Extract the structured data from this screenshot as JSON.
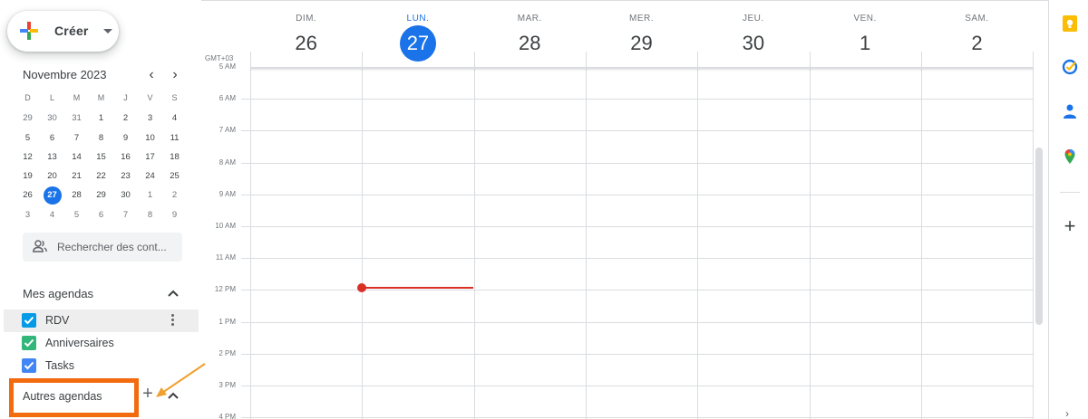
{
  "sidebar": {
    "create_label": "Créer",
    "mini_calendar": {
      "title": "Novembre 2023",
      "prev": "‹",
      "next": "›",
      "weekdays": [
        "D",
        "L",
        "M",
        "M",
        "J",
        "V",
        "S"
      ],
      "weeks": [
        [
          "29",
          "30",
          "31",
          "1",
          "2",
          "3",
          "4"
        ],
        [
          "5",
          "6",
          "7",
          "8",
          "9",
          "10",
          "11"
        ],
        [
          "12",
          "13",
          "14",
          "15",
          "16",
          "17",
          "18"
        ],
        [
          "19",
          "20",
          "21",
          "22",
          "23",
          "24",
          "25"
        ],
        [
          "26",
          "27",
          "28",
          "29",
          "30",
          "1",
          "2"
        ],
        [
          "3",
          "4",
          "5",
          "6",
          "7",
          "8",
          "9"
        ]
      ],
      "today": "27"
    },
    "search_contacts_placeholder": "Rechercher des cont...",
    "my_calendars": {
      "title": "Mes agendas",
      "items": [
        {
          "name": "RDV",
          "color": "#039be5"
        },
        {
          "name": "Anniversaires",
          "color": "#33b679"
        },
        {
          "name": "Tasks",
          "color": "#4285f4"
        }
      ]
    },
    "other_calendars": {
      "title": "Autres agendas",
      "add": "+"
    }
  },
  "week": {
    "timezone": "GMT+03",
    "days": [
      {
        "dow": "DIM.",
        "num": "26"
      },
      {
        "dow": "LUN.",
        "num": "27",
        "today": true
      },
      {
        "dow": "MAR.",
        "num": "28"
      },
      {
        "dow": "MER.",
        "num": "29"
      },
      {
        "dow": "JEU.",
        "num": "30"
      },
      {
        "dow": "VEN.",
        "num": "1"
      },
      {
        "dow": "SAM.",
        "num": "2"
      }
    ],
    "hours": [
      "5 AM",
      "6 AM",
      "7 AM",
      "8 AM",
      "9 AM",
      "10 AM",
      "11 AM",
      "12 PM",
      "1 PM",
      "2 PM",
      "3 PM",
      "4 PM"
    ]
  },
  "side_panel": {
    "icons": [
      "keep-icon",
      "tasks-icon",
      "contacts-icon",
      "maps-icon"
    ],
    "add": "+",
    "expand": "›"
  },
  "colors": {
    "accent": "#1a73e8",
    "now_line": "#d93025",
    "annotation_box": "#f26b0f",
    "annotation_arrow": "#f0a030"
  }
}
